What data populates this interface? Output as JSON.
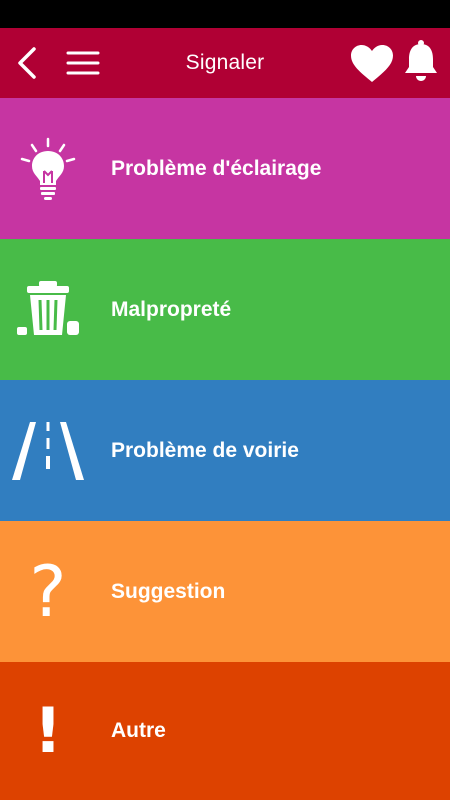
{
  "header": {
    "title": "Signaler",
    "back_icon": "chevron-left-icon",
    "menu_icon": "hamburger-menu-icon",
    "favorite_icon": "heart-icon",
    "notification_icon": "bell-icon",
    "color": "#b00034"
  },
  "categories": [
    {
      "label": "Problème d'éclairage",
      "icon": "lightbulb-icon",
      "color": "#c635a2"
    },
    {
      "label": "Malpropreté",
      "icon": "trash-can-icon",
      "color": "#48bb48"
    },
    {
      "label": "Problème de voirie",
      "icon": "road-icon",
      "color": "#317ec0"
    },
    {
      "label": "Suggestion",
      "icon": "question-mark-icon",
      "symbol": "?",
      "color": "#fd9338"
    },
    {
      "label": "Autre",
      "icon": "exclamation-mark-icon",
      "symbol": "!",
      "color": "#dd4200"
    }
  ]
}
